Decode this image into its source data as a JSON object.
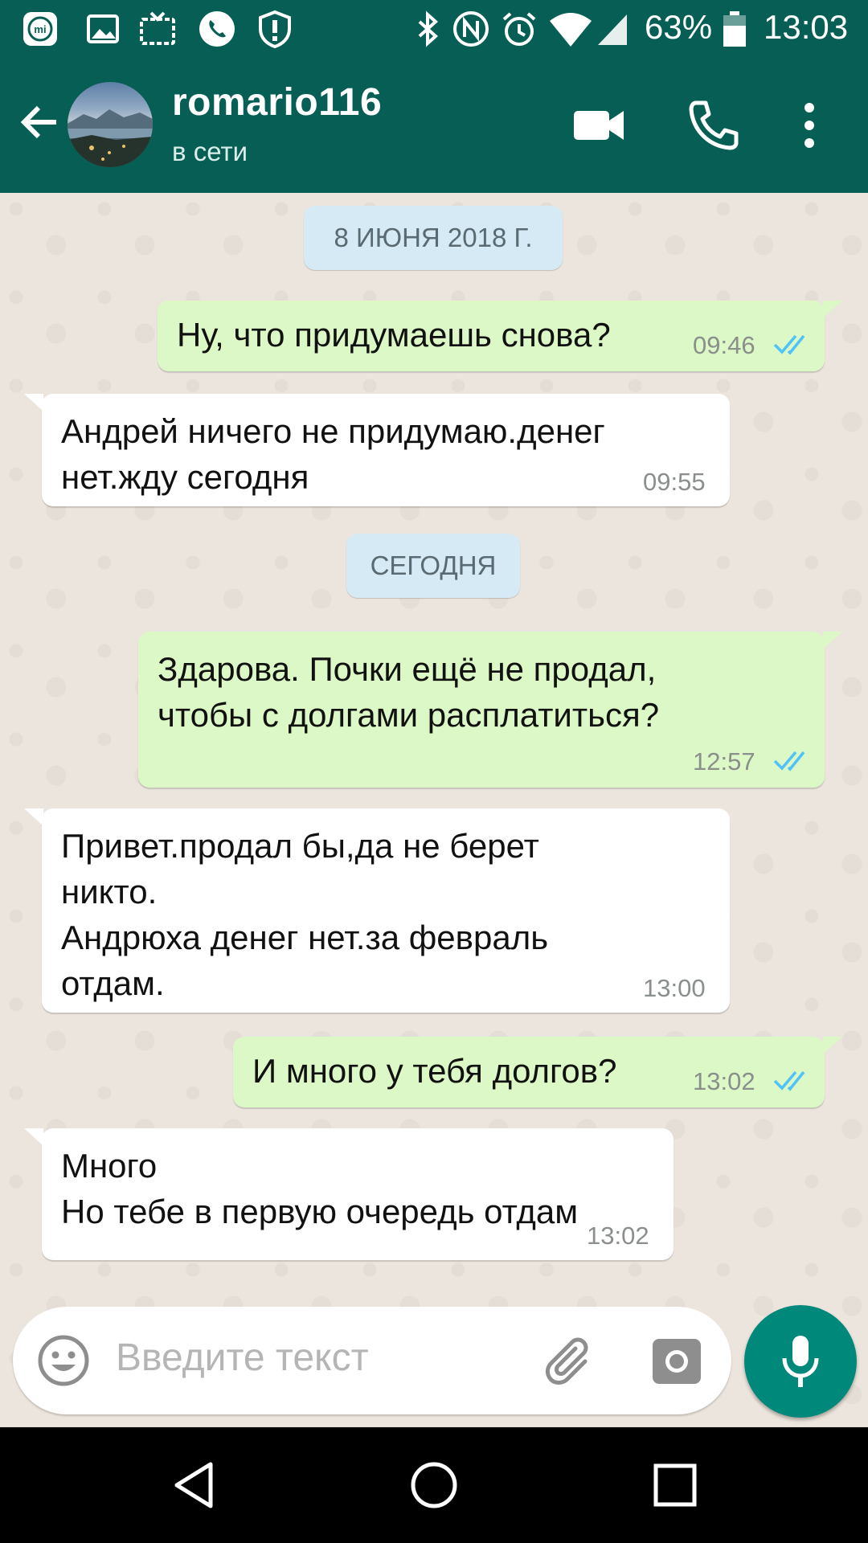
{
  "status_bar": {
    "battery": "63%",
    "time": "13:03",
    "left_icons": [
      "mi-icon",
      "image-icon",
      "tv-icon",
      "phone-icon",
      "alert-shield-icon"
    ],
    "right_icons": [
      "bluetooth-icon",
      "nfc-icon",
      "alarm-icon",
      "wifi-icon",
      "signal-icon",
      "battery-icon"
    ]
  },
  "header": {
    "contact_name": "romario116",
    "status": "в сети",
    "colors": {
      "toolbar": "#075e54"
    }
  },
  "chat": {
    "date_1": "8 ИЮНЯ 2018 Г.",
    "date_2": "СЕГОДНЯ",
    "messages": [
      {
        "direction": "out",
        "text": "Ну, что придумаешь снова?",
        "time": "09:46",
        "read": true
      },
      {
        "direction": "in",
        "text": "Андрей ничего не придумаю.денег\nнет.жду сегодня",
        "time": "09:55"
      },
      {
        "direction": "out",
        "text": "Здарова. Почки ещё не продал,\nчтобы с долгами расплатиться?",
        "time": "12:57",
        "read": true
      },
      {
        "direction": "in",
        "text": "Привет.продал бы,да не берет\nникто.\nАндрюха денег нет.за февраль\nотдам.",
        "time": "13:00"
      },
      {
        "direction": "out",
        "text": "И много у тебя долгов?",
        "time": "13:02",
        "read": true
      },
      {
        "direction": "in",
        "text": "Много\nНо тебе в первую очередь отдам",
        "time": "13:02"
      }
    ],
    "colors": {
      "outgoing": "#dcf8c6",
      "incoming": "#ffffff",
      "read_ticks": "#4fc3f7"
    }
  },
  "composer": {
    "placeholder": "Введите текст",
    "mic_color": "#00897b"
  }
}
